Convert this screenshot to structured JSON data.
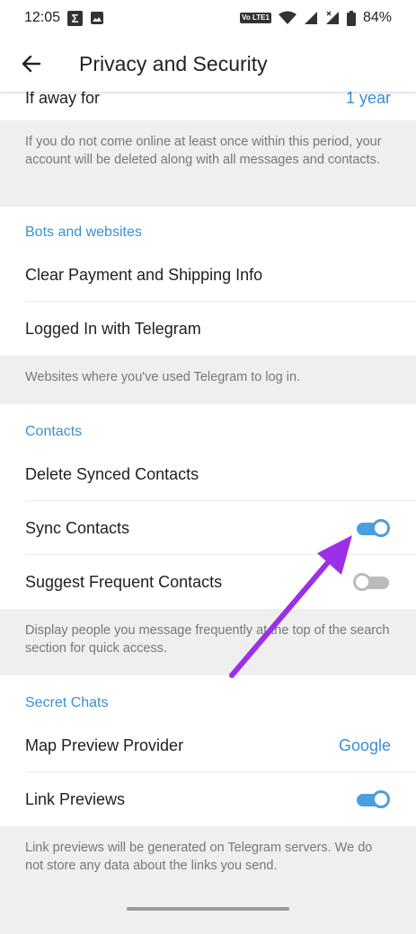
{
  "status_bar": {
    "time": "12:05",
    "left_icons": [
      "sigma-icon",
      "image-icon"
    ],
    "volte_label": "Vo LTE1",
    "battery": "84%"
  },
  "app_bar": {
    "title": "Privacy and Security"
  },
  "rows": {
    "away_for": {
      "label": "If away for",
      "value": "1 year"
    },
    "away_info": "If you do not come online at least once within this period, your account will be deleted along with all messages and contacts.",
    "bots_header": "Bots and websites",
    "clear_payment": "Clear Payment and Shipping Info",
    "logged_in": "Logged In with Telegram",
    "websites_info": "Websites where you've used Telegram to log in.",
    "contacts_header": "Contacts",
    "delete_synced": "Delete Synced Contacts",
    "sync_contacts": {
      "label": "Sync Contacts",
      "enabled": true
    },
    "suggest_frequent": {
      "label": "Suggest Frequent Contacts",
      "enabled": false
    },
    "frequent_info": "Display people you message frequently at the top of the search section for quick access.",
    "secret_header": "Secret Chats",
    "map_preview": {
      "label": "Map Preview Provider",
      "value": "Google"
    },
    "link_previews": {
      "label": "Link Previews",
      "enabled": true
    },
    "link_info": "Link previews will be generated on Telegram servers. We do not store any data about the links you send."
  },
  "colors": {
    "accent": "#3a8fd0",
    "toggle_on": "#4a9fe0",
    "toggle_off": "#bbbbbb",
    "annotation_arrow": "#9b30e8"
  }
}
